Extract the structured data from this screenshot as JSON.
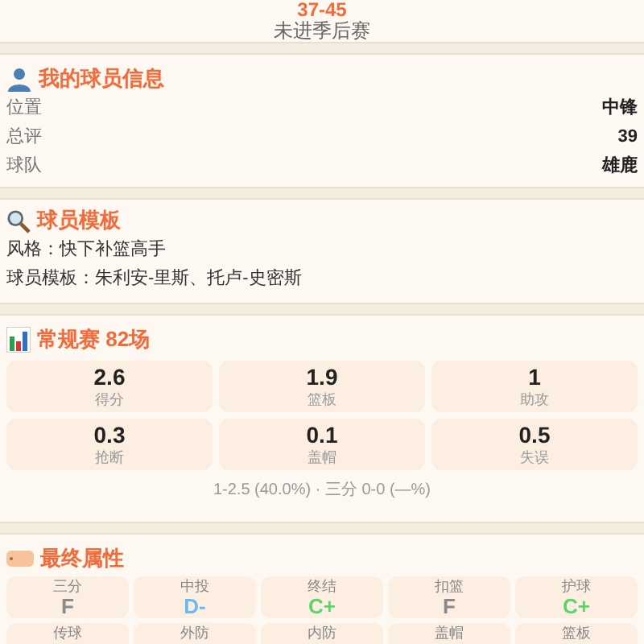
{
  "header": {
    "record": "37-45",
    "result": "未进季后赛"
  },
  "player_info": {
    "title": "我的球员信息",
    "rows": [
      {
        "label": "位置",
        "value": "中锋"
      },
      {
        "label": "总评",
        "value": "39"
      },
      {
        "label": "球队",
        "value": "雄鹿"
      }
    ]
  },
  "template": {
    "title": "球员模板",
    "lines": [
      "风格：快下补篮高手",
      "球员模板：朱利安-里斯、托卢-史密斯"
    ]
  },
  "season": {
    "title": "常规赛 82场",
    "stats": [
      {
        "value": "2.6",
        "label": "得分"
      },
      {
        "value": "1.9",
        "label": "篮板"
      },
      {
        "value": "1",
        "label": "助攻"
      },
      {
        "value": "0.3",
        "label": "抢断"
      },
      {
        "value": "0.1",
        "label": "盖帽"
      },
      {
        "value": "0.5",
        "label": "失误"
      }
    ],
    "shooting": "1-2.5 (40.0%) · 三分 0-0 (—%)"
  },
  "attributes": {
    "title": "最终属性",
    "items": [
      {
        "label": "三分",
        "grade": "F",
        "color": "#8a8a8a"
      },
      {
        "label": "中投",
        "grade": "D-",
        "color": "#6ab8f7"
      },
      {
        "label": "终结",
        "grade": "C+",
        "color": "#5ed36a"
      },
      {
        "label": "扣篮",
        "grade": "F",
        "color": "#8a8a8a"
      },
      {
        "label": "护球",
        "grade": "C+",
        "color": "#5ed36a"
      },
      {
        "label": "传球"
      },
      {
        "label": "外防"
      },
      {
        "label": "内防"
      },
      {
        "label": "盖帽"
      },
      {
        "label": "篮板"
      }
    ]
  }
}
